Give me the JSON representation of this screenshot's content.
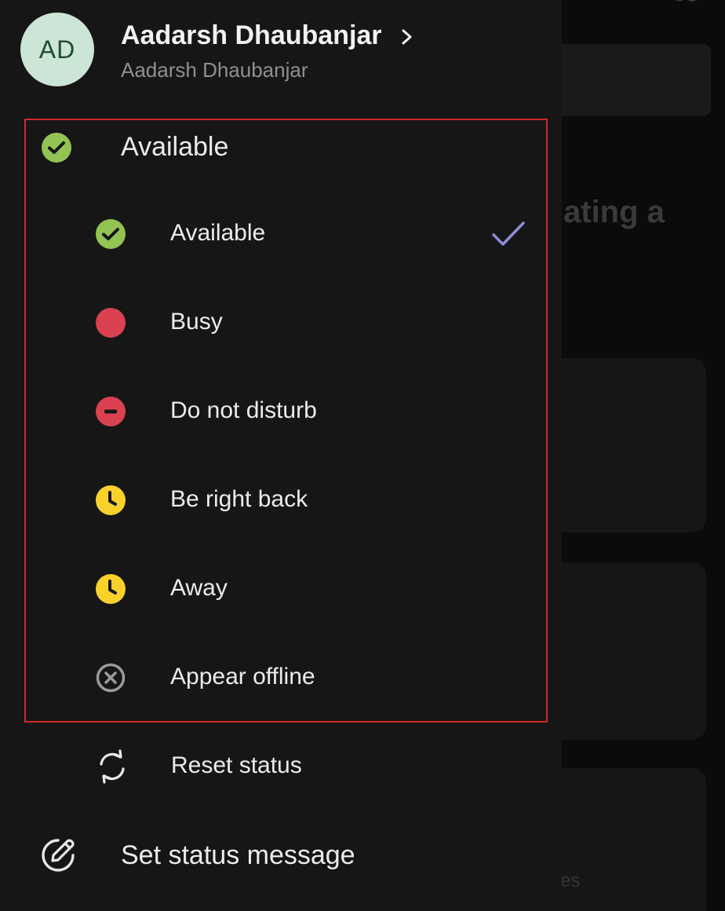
{
  "profile": {
    "initials": "AD",
    "name": "Aadarsh Dhaubanjar",
    "subtitle": "Aadarsh Dhaubanjar"
  },
  "current_status": {
    "label": "Available",
    "color": "#92c353"
  },
  "status_options": [
    {
      "label": "Available",
      "icon": "available-check-icon",
      "color": "#92c353",
      "selected": true
    },
    {
      "label": "Busy",
      "icon": "busy-dot-icon",
      "color": "#d94150",
      "selected": false
    },
    {
      "label": "Do not disturb",
      "icon": "dnd-minus-icon",
      "color": "#d94150",
      "selected": false
    },
    {
      "label": "Be right back",
      "icon": "clock-icon",
      "color": "#f8d22a",
      "selected": false
    },
    {
      "label": "Away",
      "icon": "clock-icon",
      "color": "#f8d22a",
      "selected": false
    },
    {
      "label": "Appear offline",
      "icon": "offline-x-icon",
      "color": "#9a9a9a",
      "selected": false
    }
  ],
  "actions": {
    "reset": "Reset status",
    "set_message": "Set status message"
  },
  "colors": {
    "selection_check": "#8e8cd8",
    "highlight_outline": "#d42a2a"
  },
  "background": {
    "partial_text_1": "ating a",
    "partial_text_2": "es"
  }
}
